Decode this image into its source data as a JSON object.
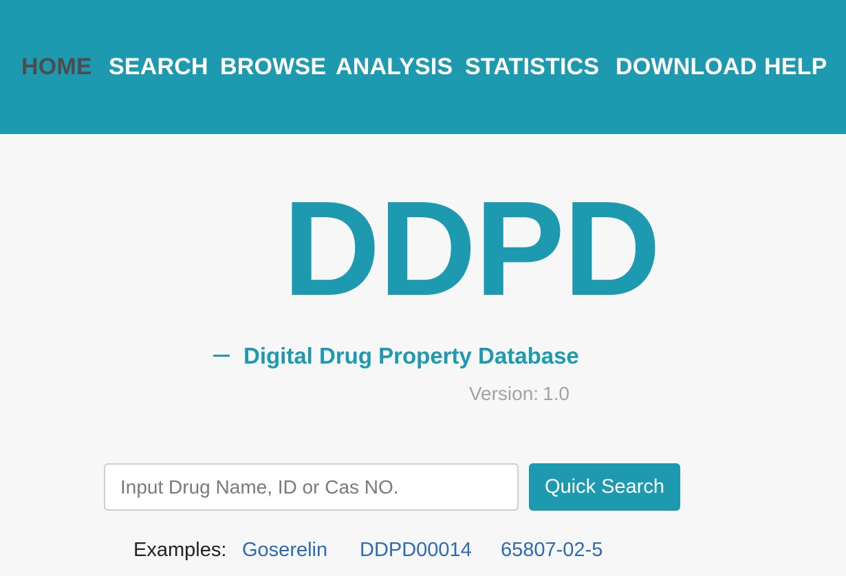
{
  "nav": {
    "items": [
      {
        "label": "HOME",
        "active": true
      },
      {
        "label": "SEARCH",
        "active": false
      },
      {
        "label": "BROWSE",
        "active": false
      },
      {
        "label": "ANALYSIS",
        "active": false
      },
      {
        "label": "STATISTICS",
        "active": false
      },
      {
        "label": "DOWNLOAD",
        "active": false
      },
      {
        "label": "HELP",
        "active": false
      }
    ]
  },
  "hero": {
    "title": "DDPD",
    "subtitle": "Digital Drug Property Database",
    "version_label": "Version:",
    "version_value": "1.0"
  },
  "search": {
    "placeholder": "Input Drug Name, ID or Cas NO.",
    "value": "",
    "button_label": "Quick Search"
  },
  "examples": {
    "label": "Examples:",
    "links": [
      "Goserelin",
      "DDPD00014",
      "65807-02-5"
    ]
  },
  "colors": {
    "brand": "#1e9ab0",
    "nav_active": "#4d4d4d",
    "link": "#2d69b4",
    "muted": "#a3a3a3",
    "background": "#f7f7f7"
  }
}
